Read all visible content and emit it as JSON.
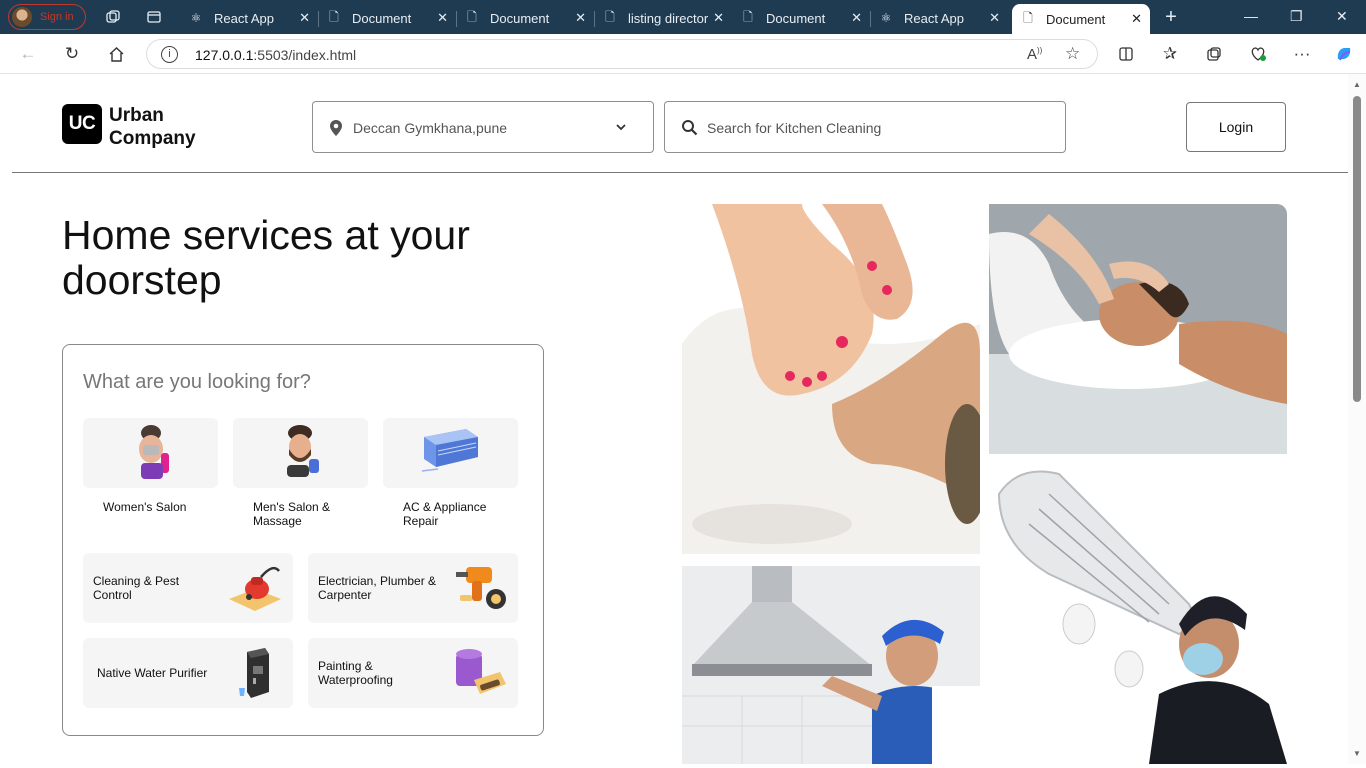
{
  "browser": {
    "profile_label": "Sign in",
    "tabs": [
      {
        "title": "React App"
      },
      {
        "title": "Document"
      },
      {
        "title": "Document"
      },
      {
        "title": "listing director"
      },
      {
        "title": "Document"
      },
      {
        "title": "React App"
      },
      {
        "title": "Document"
      }
    ],
    "url_host": "127.0.0.1",
    "url_rest": ":5503/index.html"
  },
  "header": {
    "logo_mark": "UC",
    "logo_line1": "Urban",
    "logo_line2": "Company",
    "location": "Deccan Gymkhana,pune",
    "search_placeholder": "Search for Kitchen Cleaning",
    "login_label": "Login"
  },
  "hero": {
    "title": "Home services at your doorstep"
  },
  "services": {
    "question": "What are you looking for?",
    "top": [
      {
        "label": "Women's Salon",
        "icon": "woman-facial-icon"
      },
      {
        "label": "Men's Salon & Massage",
        "icon": "man-grooming-icon"
      },
      {
        "label": "AC & Appliance Repair",
        "icon": "air-conditioner-icon"
      }
    ],
    "wide": [
      {
        "label": "Cleaning & Pest Control",
        "icon": "vacuum-cleaner-icon"
      },
      {
        "label": "Electrician, Plumber & Carpenter",
        "icon": "drill-tool-icon"
      },
      {
        "label": "Native Water Purifier",
        "icon": "water-purifier-icon"
      },
      {
        "label": "Painting & Waterproofing",
        "icon": "paint-bucket-icon"
      }
    ]
  },
  "gallery": [
    {
      "name": "pedicure-photo"
    },
    {
      "name": "head-massage-photo"
    },
    {
      "name": "kitchen-chimney-repair-photo"
    },
    {
      "name": "ac-repair-photo"
    }
  ],
  "colors": {
    "chrome": "#1f3b52",
    "accent_pink": "#e8325f",
    "tile_bg": "#f5f5f5"
  }
}
